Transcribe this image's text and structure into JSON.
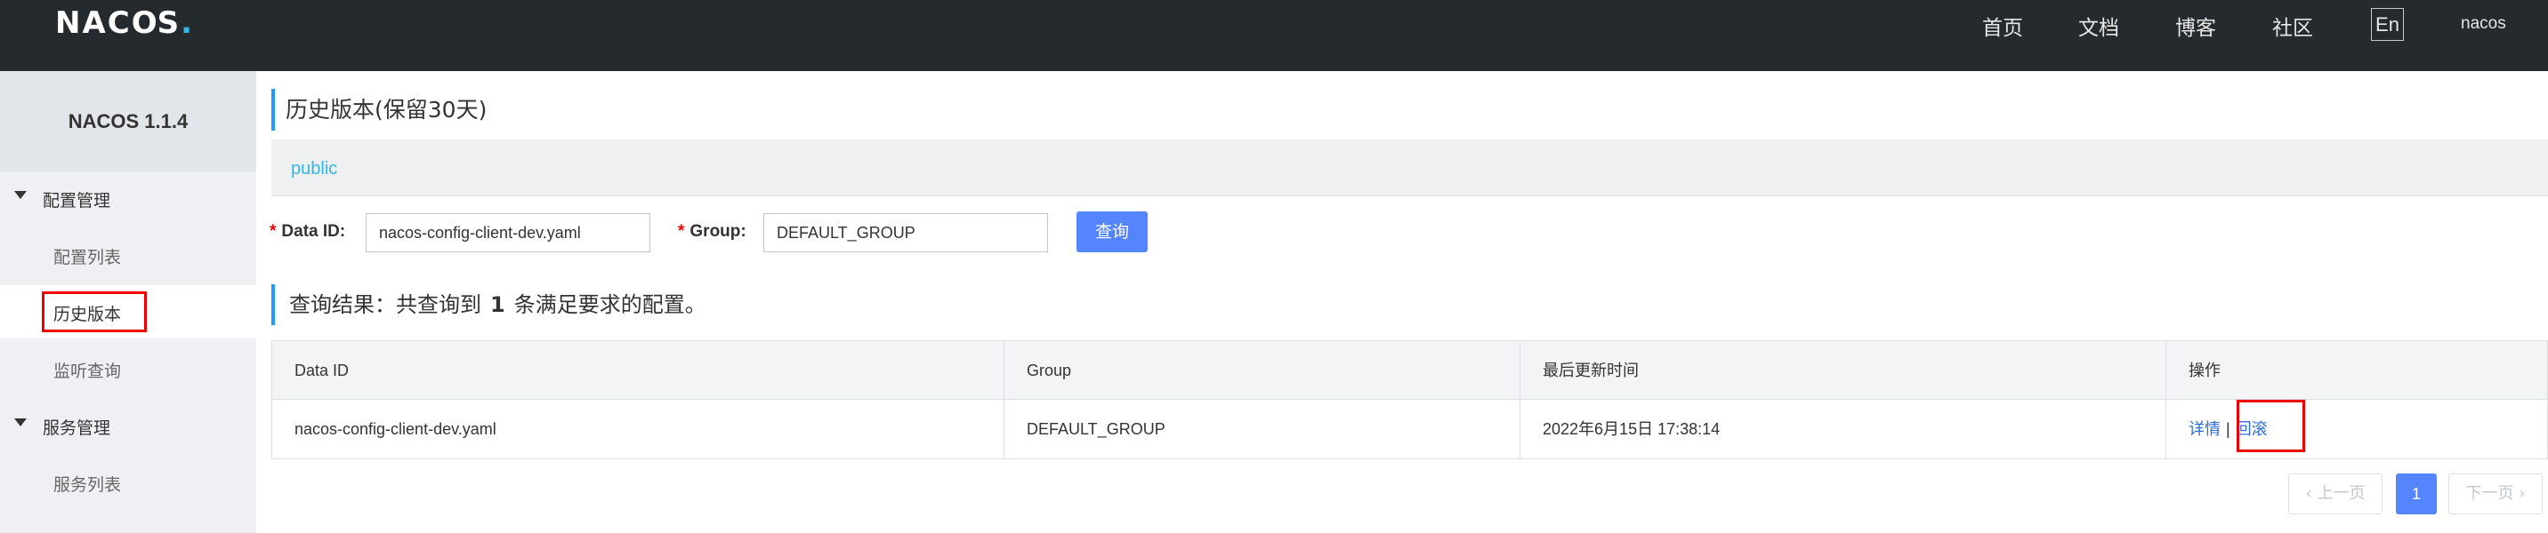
{
  "header": {
    "logo": "NACOS.",
    "nav": [
      "首页",
      "文档",
      "博客",
      "社区"
    ],
    "lang": "En",
    "user": "nacos"
  },
  "sidebar": {
    "version": "NACOS 1.1.4",
    "groups": [
      {
        "label": "配置管理",
        "items": [
          "配置列表",
          "历史版本",
          "监听查询"
        ]
      },
      {
        "label": "服务管理",
        "items": [
          "服务列表"
        ]
      }
    ],
    "active_item": "历史版本"
  },
  "page": {
    "title": "历史版本(保留30天)",
    "namespace": "public"
  },
  "form": {
    "data_id_label": "Data ID:",
    "data_id_value": "nacos-config-client-dev.yaml",
    "group_label": "Group:",
    "group_value": "DEFAULT_GROUP",
    "query_label": "查询"
  },
  "result": {
    "prefix": "查询结果：共查询到",
    "count": "1",
    "suffix": "条满足要求的配置。"
  },
  "table": {
    "columns": [
      "Data ID",
      "Group",
      "最后更新时间",
      "操作"
    ],
    "rows": [
      {
        "data_id": "nacos-config-client-dev.yaml",
        "group": "DEFAULT_GROUP",
        "updated": "2022年6月15日 17:38:14",
        "actions": [
          "详情",
          "回滚"
        ]
      }
    ]
  },
  "pagination": {
    "prev": "上一页",
    "current": "1",
    "next": "下一页"
  },
  "colors": {
    "topbar": "#252a2f",
    "accent": "#5584ff",
    "link": "#2e6cd8",
    "highlight": "#ee0000"
  }
}
